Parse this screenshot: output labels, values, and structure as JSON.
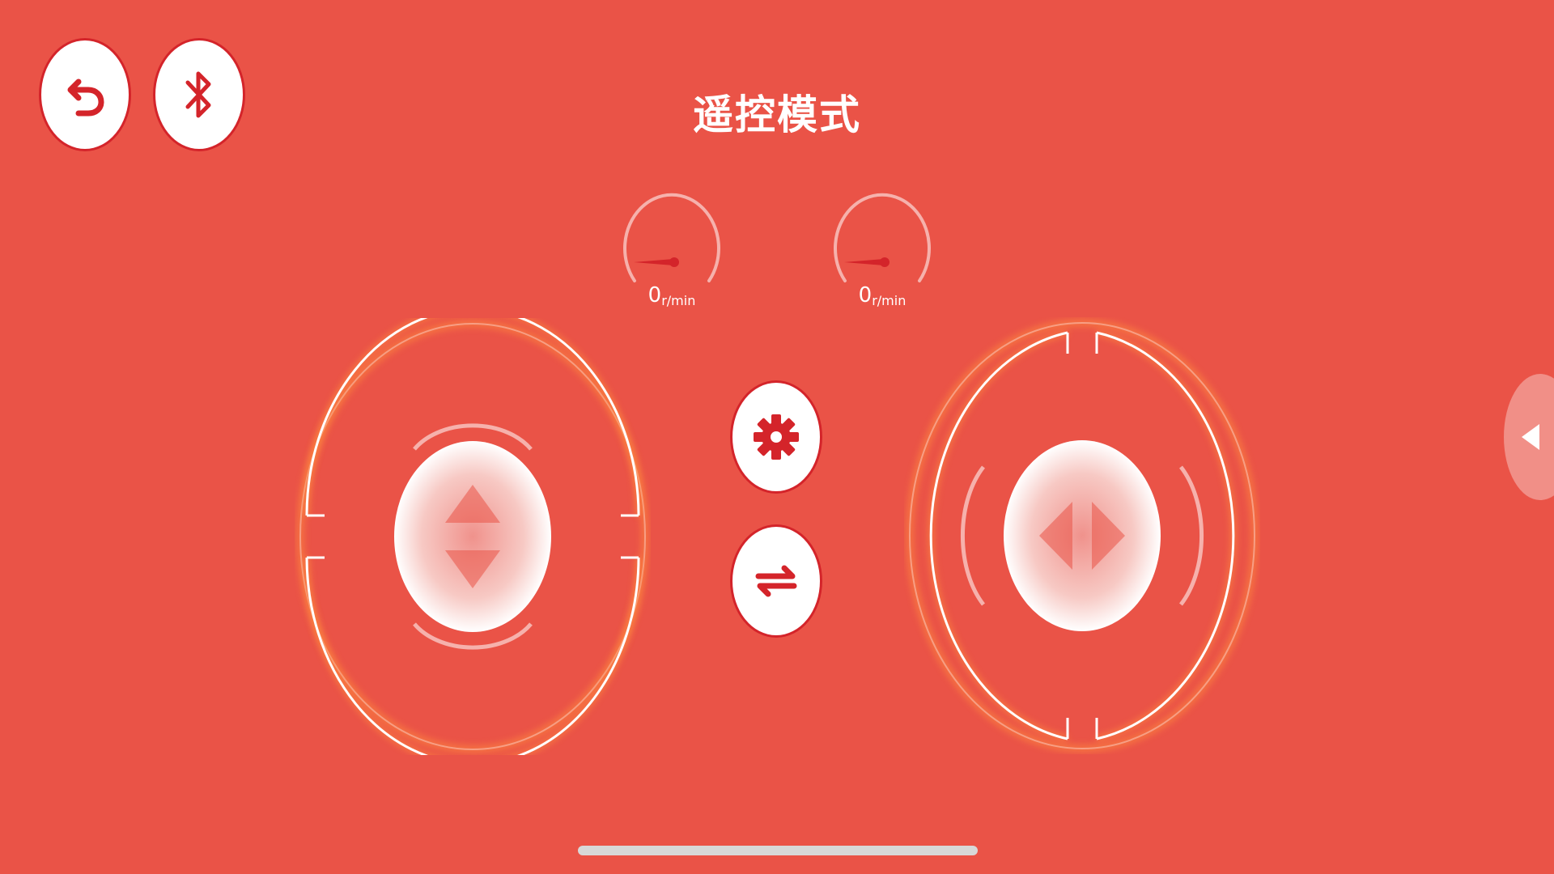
{
  "header": {
    "title": "遥控模式"
  },
  "toolbar": {
    "back_icon": "back-arrow-icon",
    "bluetooth_icon": "bluetooth-icon"
  },
  "gauges": [
    {
      "value": "0",
      "unit": "r/min"
    },
    {
      "value": "0",
      "unit": "r/min"
    }
  ],
  "controls": {
    "left_joystick": "up-down-arrows-icon",
    "right_joystick": "left-right-arrows-icon",
    "settings_icon": "gear-icon",
    "switch_icon": "swap-arrows-icon",
    "side_tab_icon": "triangle-left-icon"
  },
  "colors": {
    "background": "#EA5347",
    "accent": "#D4242A",
    "ring": "#FFFFFF",
    "glow": "#FF8A3D"
  }
}
